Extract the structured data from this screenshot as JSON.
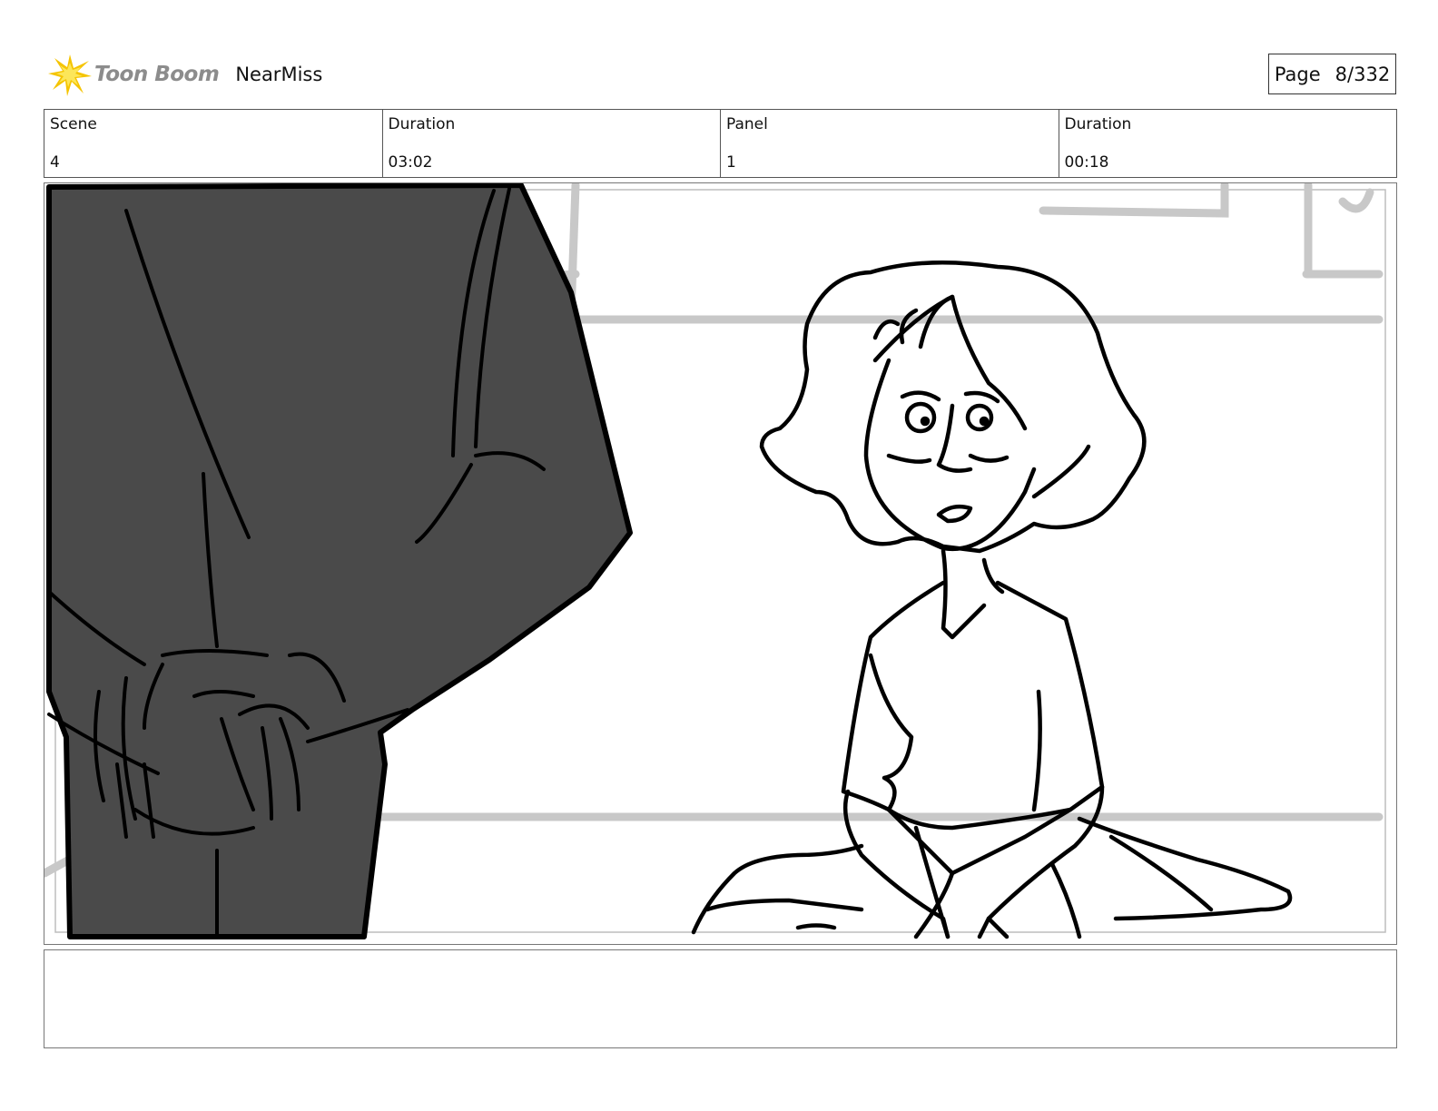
{
  "header": {
    "logo_text": "Toon Boom",
    "project_title": "NearMiss",
    "page_label": "Page",
    "page_number": "8/332"
  },
  "info": [
    {
      "label": "Scene",
      "value": "4"
    },
    {
      "label": "Duration",
      "value": "03:02"
    },
    {
      "label": "Panel",
      "value": "1"
    },
    {
      "label": "Duration",
      "value": "00:18"
    }
  ],
  "panel": {
    "description": "",
    "colors": {
      "figure_fill": "#4a4a4a",
      "line": "#000000",
      "background_lines": "#c8c8c8"
    }
  },
  "notes": {
    "text": ""
  }
}
